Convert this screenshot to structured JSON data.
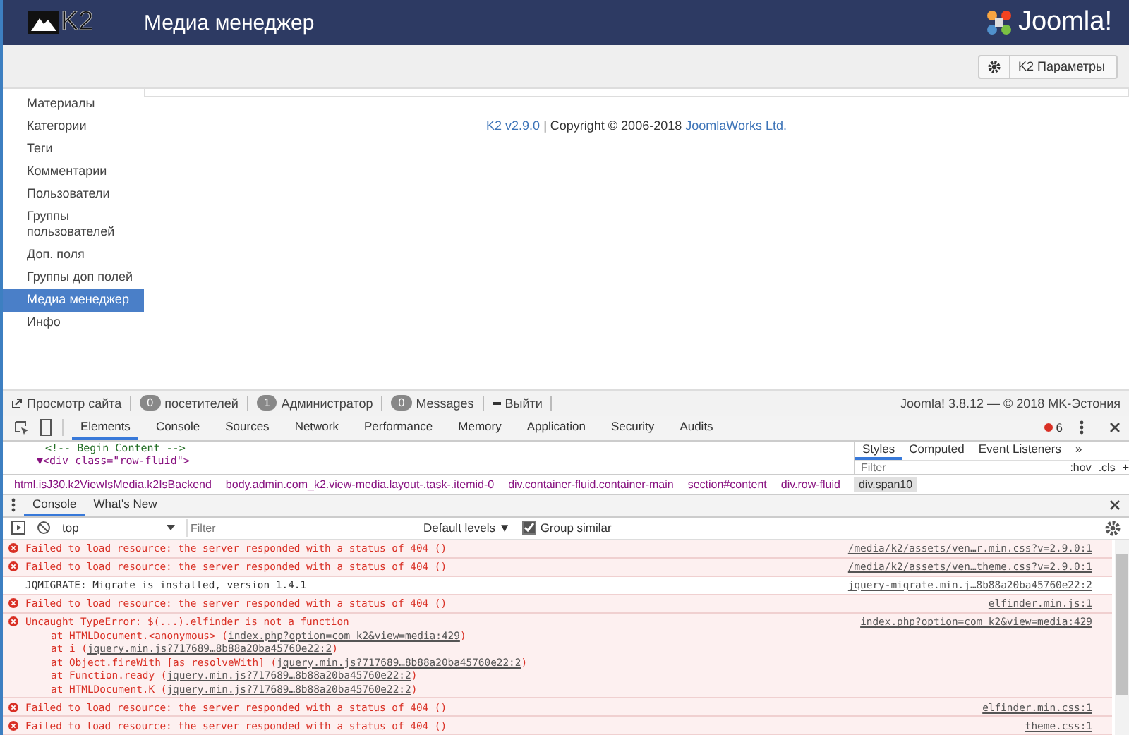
{
  "header": {
    "logo": "K2",
    "title": "Медиа менеджер",
    "brand": "Joomla!"
  },
  "toolbar": {
    "button": "K2 Параметры"
  },
  "sidebar": {
    "items": [
      {
        "label": "Материалы",
        "selected": false
      },
      {
        "label": "Категории",
        "selected": false
      },
      {
        "label": "Теги",
        "selected": false
      },
      {
        "label": "Комментарии",
        "selected": false
      },
      {
        "label": "Пользователи",
        "selected": false
      },
      {
        "label": "Группы пользователей",
        "selected": false
      },
      {
        "label": "Доп. поля",
        "selected": false
      },
      {
        "label": "Группы доп полей",
        "selected": false
      },
      {
        "label": "Медиа менеджер",
        "selected": true
      },
      {
        "label": "Инфо",
        "selected": false
      }
    ]
  },
  "footer": {
    "version_link": "K2 v2.9.0",
    "copyright": "| Copyright © 2006-2018",
    "company_link": "JoomlaWorks Ltd."
  },
  "status_bar": {
    "items": [
      {
        "kind": "link",
        "label": "Просмотр сайта"
      },
      {
        "kind": "count",
        "count": "0",
        "label": "посетителей"
      },
      {
        "kind": "count",
        "count": "1",
        "label": "Администратор"
      },
      {
        "kind": "count",
        "count": "0",
        "label": "Messages"
      },
      {
        "kind": "logout",
        "label": "Выйти"
      }
    ],
    "right": "Joomla! 3.8.12 — © 2018 MK-Эстония"
  },
  "devtools": {
    "tabs": [
      {
        "label": "Elements",
        "selected": true
      },
      {
        "label": "Console",
        "selected": false
      },
      {
        "label": "Sources",
        "selected": false
      },
      {
        "label": "Network",
        "selected": false
      },
      {
        "label": "Performance",
        "selected": false
      },
      {
        "label": "Memory",
        "selected": false
      },
      {
        "label": "Application",
        "selected": false
      },
      {
        "label": "Security",
        "selected": false
      },
      {
        "label": "Audits",
        "selected": false
      }
    ],
    "error_count": "6",
    "dom_lines": [
      "<!-- Begin Content -->",
      "▼<div class=\"row-fluid\">"
    ],
    "styles_tabs": [
      {
        "label": "Styles",
        "selected": true
      },
      {
        "label": "Computed",
        "selected": false
      },
      {
        "label": "Event Listeners",
        "selected": false
      }
    ],
    "styles_more": "»",
    "styles_filter": {
      "placeholder": "Filter"
    },
    "styles_actions": [
      ":hov",
      ".cls",
      "+"
    ],
    "breadcrumbs": [
      {
        "label": "html.isJ30.k2ViewIsMedia.k2IsBackend",
        "selected": false
      },
      {
        "label": "body.admin.com_k2.view-media.layout-.task-.itemid-0",
        "selected": false
      },
      {
        "label": "div.container-fluid.container-main",
        "selected": false
      },
      {
        "label": "section#content",
        "selected": false
      },
      {
        "label": "div.row-fluid",
        "selected": false
      },
      {
        "label": "div.span10",
        "selected": true
      }
    ],
    "drawer_tabs": [
      {
        "label": "Console",
        "selected": true
      },
      {
        "label": "What's New",
        "selected": false
      }
    ],
    "context": "top",
    "filter": {
      "placeholder": "Filter"
    },
    "levels": "Default levels ▼",
    "group_similar": {
      "label": "Group similar",
      "checked": true
    },
    "messages": [
      {
        "kind": "error",
        "text": "Failed to load resource: the server responded with a status of 404 ()",
        "source": "/media/k2/assets/ven…r.min.css?v=2.9.0:1"
      },
      {
        "kind": "error",
        "text": "Failed to load resource: the server responded with a status of 404 ()",
        "source": "/media/k2/assets/ven…theme.css?v=2.9.0:1"
      },
      {
        "kind": "info",
        "text": "JQMIGRATE: Migrate is installed, version 1.4.1",
        "source": "jquery-migrate.min.j…8b88a20ba45760e22:2"
      },
      {
        "kind": "error",
        "text": "Failed to load resource: the server responded with a status of 404 ()",
        "source": "elfinder.min.js:1"
      },
      {
        "kind": "error",
        "text": "Uncaught TypeError: $(...).elfinder is not a function",
        "source": "index.php?option=com_k2&view=media:429",
        "stack": [
          {
            "text": "at HTMLDocument.<anonymous> (",
            "link": "index.php?option=com_k2&view=media:429",
            "end": ")"
          },
          {
            "text": "at i (",
            "link": "jquery.min.js?717689…8b88a20ba45760e22:2",
            "end": ")"
          },
          {
            "text": "at Object.fireWith [as resolveWith] (",
            "link": "jquery.min.js?717689…8b88a20ba45760e22:2",
            "end": ")"
          },
          {
            "text": "at Function.ready (",
            "link": "jquery.min.js?717689…8b88a20ba45760e22:2",
            "end": ")"
          },
          {
            "text": "at HTMLDocument.K (",
            "link": "jquery.min.js?717689…8b88a20ba45760e22:2",
            "end": ")"
          }
        ]
      },
      {
        "kind": "error",
        "text": "Failed to load resource: the server responded with a status of 404 ()",
        "source": "elfinder.min.css:1"
      },
      {
        "kind": "error",
        "text": "Failed to load resource: the server responded with a status of 404 ()",
        "source": "theme.css:1"
      }
    ]
  }
}
